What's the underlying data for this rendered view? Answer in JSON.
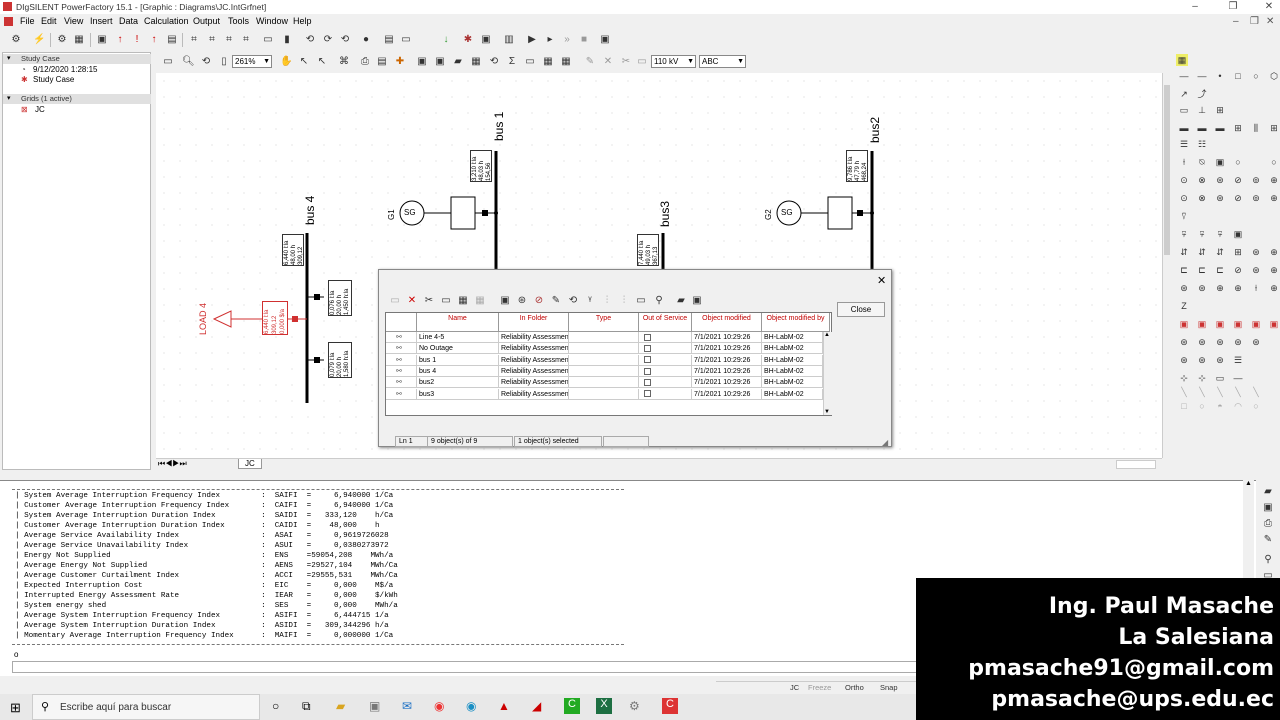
{
  "window": {
    "title": "DIgSILENT PowerFactory 15.1 - [Graphic : Diagrams\\JC.IntGrfnet]",
    "controls": [
      "–",
      "❐",
      "✕"
    ],
    "doc_controls": [
      "–",
      "❐",
      "✕"
    ]
  },
  "menu": [
    "File",
    "Edit",
    "View",
    "Insert",
    "Data",
    "Calculation",
    "Output",
    "Tools",
    "Window",
    "Help"
  ],
  "toolbar2": {
    "zoom": "261%",
    "voltage": "110 kV",
    "phase": "ABC"
  },
  "tree": {
    "study_case_header": "Study Case",
    "study_case_date": "9/12/2020 1:28:15",
    "study_case_name": "Study Case",
    "grids_header": "Grids (1 active)",
    "grid_name": "JC"
  },
  "diagram": {
    "buses": [
      "bus 1",
      "bus2",
      "bus3",
      "bus 4"
    ],
    "generators": [
      "G1",
      "G2"
    ],
    "gen_symbol": "SG",
    "load": "LOAD 4",
    "meters": {
      "bus1": [
        "3,210 l:la",
        "48,03 h",
        "154,56"
      ],
      "bus2": [
        "9,786 l:la",
        "47,79 h",
        "468,24"
      ],
      "bus3": [
        "7,440 l:la",
        "49,03 h",
        "367,13"
      ],
      "bus4": [
        "6,440 l:la",
        "48,00 h",
        "309,12"
      ],
      "line_a": [
        "0,076 l:la",
        "20,00 h",
        "1,450 h:la"
      ],
      "line_b": [
        "0,079 l:la",
        "20,00 h",
        "1,580 h:la"
      ],
      "load4": [
        "6,440 l:la",
        "309,12",
        "0,000 $/a"
      ]
    },
    "tab": "JC"
  },
  "dialog": {
    "close_label": "Close",
    "columns": [
      "Name",
      "In Folder",
      "Type",
      "Out of Service",
      "Object modified",
      "Object modified by"
    ],
    "rows": [
      {
        "name": "Line 4-5",
        "folder": "Reliability Assessment",
        "type": "",
        "modified": "7/1/2021 10:29:26",
        "by": "BH-LabM-02"
      },
      {
        "name": "No Outage",
        "folder": "Reliability Assessment",
        "type": "",
        "modified": "7/1/2021 10:29:26",
        "by": "BH-LabM-02"
      },
      {
        "name": "bus 1",
        "folder": "Reliability Assessment",
        "type": "",
        "modified": "7/1/2021 10:29:26",
        "by": "BH-LabM-02"
      },
      {
        "name": "bus 4",
        "folder": "Reliability Assessment",
        "type": "",
        "modified": "7/1/2021 10:29:26",
        "by": "BH-LabM-02"
      },
      {
        "name": "bus2",
        "folder": "Reliability Assessment",
        "type": "",
        "modified": "7/1/2021 10:29:26",
        "by": "BH-LabM-02"
      },
      {
        "name": "bus3",
        "folder": "Reliability Assessment",
        "type": "",
        "modified": "7/1/2021 10:29:26",
        "by": "BH-LabM-02"
      }
    ],
    "status": {
      "line": "Ln 1",
      "objects": "9 object(s) of 9",
      "selected": "1 object(s) selected"
    }
  },
  "output": {
    "lines": [
      "| System Average Interruption Frequency Index         :  SAIFI  =     6,940000 1/Ca",
      "| Customer Average Interruption Frequency Index       :  CAIFI  =     6,940000 1/Ca",
      "| System Average Interruption Duration Index          :  SAIDI  =   333,120    h/Ca",
      "| Customer Average Interruption Duration Index        :  CAIDI  =    48,000    h",
      "| Average Service Availability Index                  :  ASAI   =     0,9619726028",
      "| Average Service Unavailability Index                :  ASUI   =     0,0380273972",
      "| Energy Not Supplied                                 :  ENS    =59054,208    MWh/a",
      "| Average Energy Not Supplied                         :  AENS   =29527,104    MWh/Ca",
      "| Average Customer Curtailment Index                  :  ACCI   =29555,531    MWh/Ca",
      "| Expected Interruption Cost                          :  EIC    =     0,000    M$/a",
      "| Interrupted Energy Assessment Rate                  :  IEAR   =     0,000    $/kWh",
      "| System energy shed                                  :  SES    =     0,000    MWh/a",
      "| Average System Interruption Frequency Index         :  ASIFI  =     6,444715 1/a",
      "| Average System Interruption Duration Index          :  ASIDI  =   309,344296 h/a",
      "| Momentary Average Interruption Frequency Index      :  MAIFI  =     0,000000 1/Ca"
    ],
    "prompt": "o"
  },
  "statusbar": {
    "grid": "JC",
    "freeze": "Freeze",
    "ortho": "Ortho",
    "snap": "Snap"
  },
  "overlay": [
    "Ing. Paul Masache",
    "La Salesiana",
    "pmasache91@gmail.com",
    "pmasache@ups.edu.ec"
  ],
  "taskbar": {
    "search_placeholder": "Escribe aquí para buscar"
  },
  "colors": {
    "load": "#d03030",
    "header_text": "#c00000",
    "overlay_bg": "#000000"
  }
}
